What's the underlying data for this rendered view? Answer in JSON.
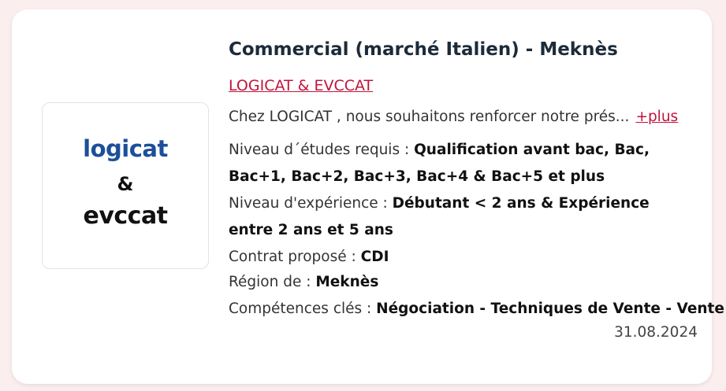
{
  "job": {
    "title": "Commercial (marché Italien) - Meknès",
    "company": "LOGICAT & EVCCAT",
    "description": "Chez LOGICAT , nous souhaitons renforcer notre prés...",
    "more_link": "+plus",
    "education": {
      "label": "Niveau d´études requis : ",
      "value": "Qualification avant bac, Bac, Bac+1, Bac+2, Bac+3, Bac+4 & Bac+5 et plus"
    },
    "experience": {
      "label": "Niveau d'expérience : ",
      "value": "Débutant < 2 ans & Expérience entre 2 ans et 5 ans"
    },
    "contract": {
      "label": "Contrat proposé : ",
      "value": "CDI"
    },
    "region": {
      "label": "Région de : ",
      "value": "Meknès"
    },
    "skills": {
      "label": "Compétences clés : ",
      "value": "Négociation - Techniques de Vente - Vente"
    },
    "date": "31.08.2024"
  },
  "logo": {
    "line1": "logicat",
    "line2": "&",
    "line3": "evccat"
  },
  "colors": {
    "accent": "#c0143c",
    "logo_blue": "#1d4f9a",
    "page_bg": "#fbeeee"
  }
}
